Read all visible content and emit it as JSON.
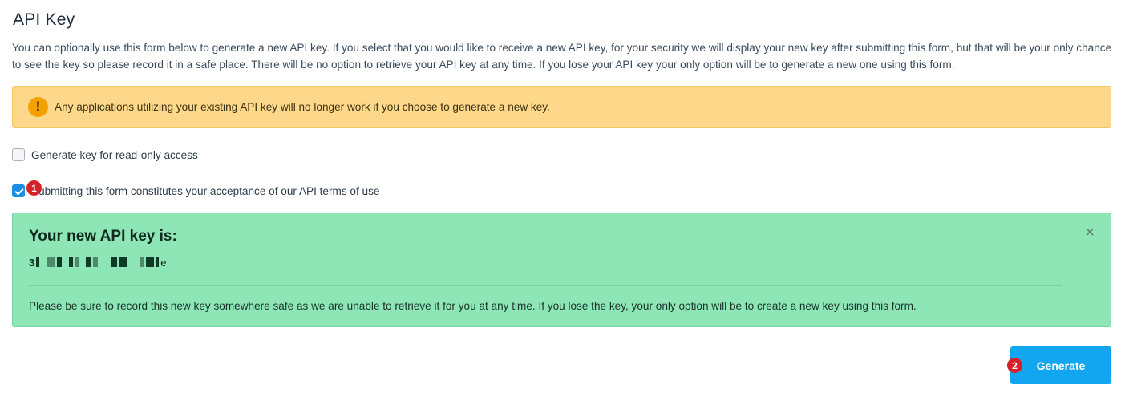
{
  "page": {
    "title": "API Key",
    "intro": "You can optionally use this form below to generate a new API key. If you select that you would like to receive a new API key, for your security we will display your new key after submitting this form, but that will be your only chance to see the key so please record it in a safe place. There will be no option to retrieve your API key at any time. If you lose your API key your only option will be to generate a new one using this form."
  },
  "warning": {
    "icon": "exclamation-icon",
    "text": "Any applications utilizing your existing API key will no longer work if you choose to generate a new key."
  },
  "options": {
    "readonly": {
      "label": "Generate key for read-only access",
      "checked": false
    },
    "terms": {
      "label": "Submitting this form constitutes your acceptance of our API terms of use",
      "checked": true
    }
  },
  "result": {
    "heading": "Your new API key is:",
    "key_prefix": "3",
    "key_suffix": "e",
    "note": "Please be sure to record this new key somewhere safe as we are unable to retrieve it for you at any time. If you lose the key, your only option will be to create a new key using this form.",
    "close_symbol": "×"
  },
  "actions": {
    "generate_label": "Generate"
  },
  "annotations": {
    "badge_1": "1",
    "badge_2": "2"
  },
  "colors": {
    "warning_bg": "#fdd78a",
    "success_bg": "#8ee5b6",
    "primary": "#11a6ef",
    "badge": "#d6202a"
  }
}
